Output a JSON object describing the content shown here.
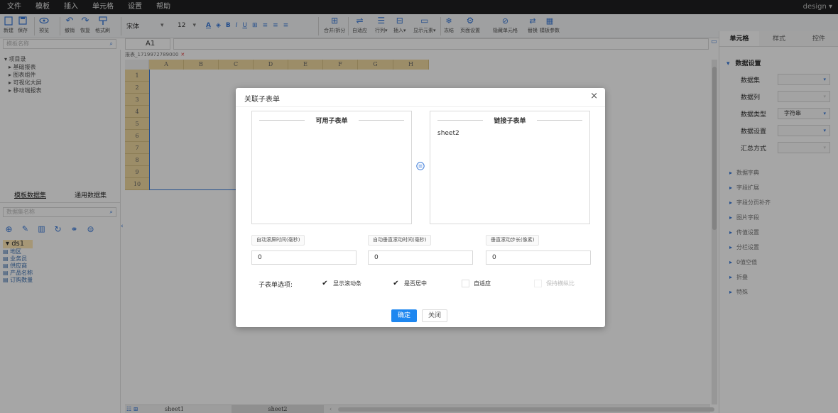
{
  "menu": [
    "文件",
    "模板",
    "插入",
    "单元格",
    "设置",
    "帮助"
  ],
  "user": "design",
  "toolbar": {
    "new": "新建",
    "save": "保存",
    "preview": "预览",
    "undo": "撤销",
    "redo": "恢复",
    "format_painter": "格式刷",
    "font": "宋体",
    "font_size": "12",
    "merge": "合并/拆分",
    "autofit": "自适应",
    "row_col": "行列",
    "insert": "插入",
    "show_element": "显示元素",
    "freeze": "冻结",
    "page_setup": "页面设置",
    "hide_cell": "隐藏单元格",
    "replace": "替换",
    "template_params": "模板参数"
  },
  "template_search_placeholder": "模板名称",
  "name_box": "A1",
  "tree": [
    "▾ 项目录",
    "▸ 基础报表",
    "▸ 图表组件",
    "▸ 可视化大屏",
    "▸ 移动端报表"
  ],
  "dataset_tabs": [
    "模板数据集",
    "通用数据集"
  ],
  "dataset_search_placeholder": "数据集名称",
  "dataset_tree": {
    "root": "▾ ds1",
    "fields": [
      "地区",
      "业务员",
      "供应商",
      "产品名称",
      "订购数量"
    ]
  },
  "sheet": {
    "tab": "报表_1719972789000",
    "columns": [
      "A",
      "B",
      "C",
      "D",
      "E",
      "F",
      "G",
      "H"
    ],
    "rows": [
      "1",
      "2",
      "3",
      "4",
      "5",
      "6",
      "7",
      "8",
      "9",
      "10"
    ],
    "bottom_tabs": [
      "sheet1",
      "sheet2"
    ]
  },
  "right_panel": {
    "tabs": [
      "单元格",
      "样式",
      "控件"
    ],
    "section": "数据设置",
    "props": [
      {
        "label": "数据集",
        "value": ""
      },
      {
        "label": "数据列",
        "value": ""
      },
      {
        "label": "数据类型",
        "value": "字符串"
      },
      {
        "label": "数据设置",
        "value": ""
      },
      {
        "label": "汇总方式",
        "value": ""
      }
    ],
    "sections": [
      "数据字典",
      "字段扩展",
      "字段分页补齐",
      "图片字段",
      "传值设置",
      "分栏设置",
      "0值空值",
      "折叠",
      "特殊"
    ]
  },
  "modal": {
    "title": "关联子表单",
    "available_header": "可用子表单",
    "linked_header": "链接子表单",
    "linked_items": [
      "sheet2"
    ],
    "fields": [
      {
        "label": "自动滚屏时间(毫秒)",
        "value": "0"
      },
      {
        "label": "自动垂直滚动时间(毫秒)",
        "value": "0"
      },
      {
        "label": "垂直滚动步长(像素)",
        "value": "0"
      }
    ],
    "options_label": "子表单选项:",
    "options": [
      {
        "label": "显示滚动条",
        "checked": true,
        "disabled": false
      },
      {
        "label": "是否居中",
        "checked": true,
        "disabled": false
      },
      {
        "label": "自适应",
        "checked": false,
        "disabled": false
      },
      {
        "label": "保持横纵比",
        "checked": false,
        "disabled": true
      }
    ],
    "ok": "确定",
    "close": "关闭"
  }
}
